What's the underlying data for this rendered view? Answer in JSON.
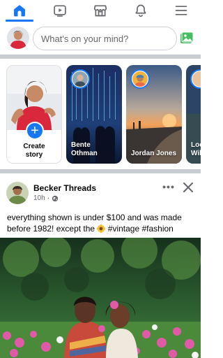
{
  "nav": {
    "items": [
      {
        "icon": "home-icon",
        "active": true
      },
      {
        "icon": "watch-icon",
        "active": false
      },
      {
        "icon": "marketplace-icon",
        "active": false
      },
      {
        "icon": "bell-icon",
        "active": false
      },
      {
        "icon": "menu-icon",
        "active": false
      }
    ],
    "accent": "#1877f2"
  },
  "composer": {
    "placeholder": "What's on your mind?",
    "photo_icon": "photo-icon"
  },
  "stories": {
    "create_label_line1": "Create",
    "create_label_line2": "story",
    "items": [
      {
        "name_line1": "Bente",
        "name_line2": "Othman"
      },
      {
        "name_line1": "Jordan Jones",
        "name_line2": ""
      },
      {
        "name_line1": "Loc",
        "name_line2": "Wil"
      }
    ]
  },
  "post": {
    "author": "Becker Threads",
    "time": "10h",
    "visibility_icon": "globe-icon",
    "text_line1": "everything shown is under $100 and was made",
    "text_line2_start": "before 1982! except the ",
    "hashtags": "#vintage #fashion"
  },
  "colors": {
    "brand": "#1877f2",
    "secondary_text": "#65676b",
    "divider": "#c9ccd1"
  }
}
